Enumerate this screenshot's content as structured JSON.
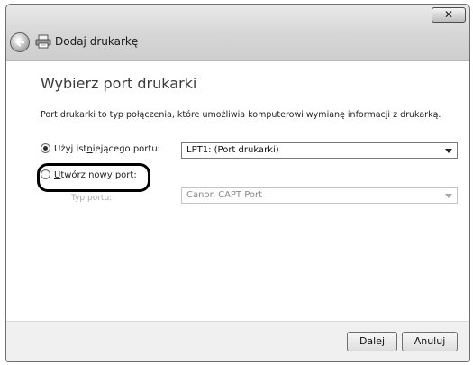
{
  "window": {
    "title": "Dodaj drukarkę",
    "close_label": "✕"
  },
  "page": {
    "heading": "Wybierz port drukarki",
    "description": "Port drukarki to typ połączenia, które umożliwia komputerowi wymianę informacji z drukarką."
  },
  "options": {
    "existing_port": {
      "label_pre": "Użyj ist",
      "label_underlined": "n",
      "label_post": "iejącego portu:",
      "checked": true,
      "selected_value": "LPT1: (Port drukarki)"
    },
    "new_port": {
      "label_underlined": "U",
      "label_post": "twórz nowy port:",
      "checked": false,
      "port_type_label": "Typ portu:",
      "port_type_value": "Canon CAPT Port"
    }
  },
  "footer": {
    "next_label": "Dalej",
    "cancel_label": "Anuluj"
  },
  "icons": {
    "back": "back-arrow-icon",
    "printer": "printer-icon",
    "close": "close-icon"
  }
}
